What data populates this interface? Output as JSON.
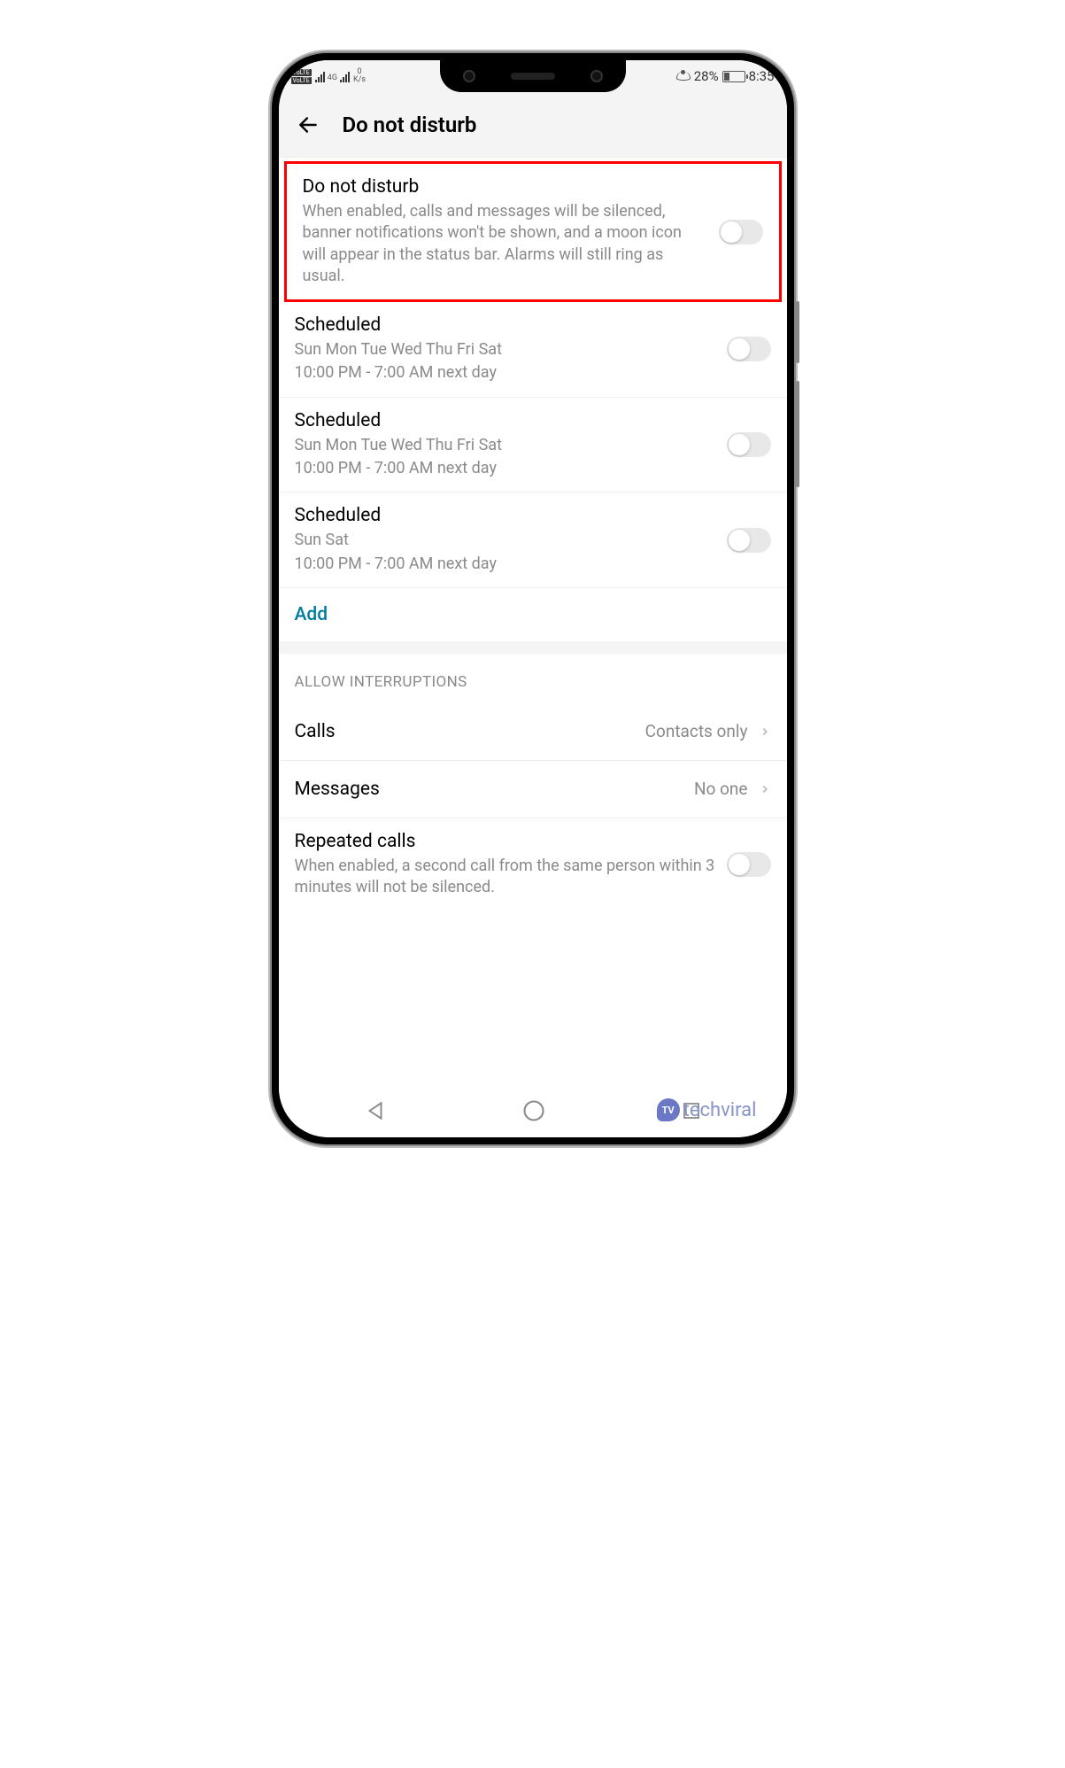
{
  "status": {
    "volte": "VoLTE",
    "net": "4G",
    "speed_top": "0",
    "speed_unit": "K/s",
    "battery_pct": "28%",
    "time": "8:35"
  },
  "header": {
    "title": "Do not disturb"
  },
  "dnd": {
    "title": "Do not disturb",
    "desc": "When enabled, calls and messages will be silenced, banner notifications won't be shown, and a moon icon will appear in the status bar. Alarms will still ring as usual."
  },
  "scheduled": [
    {
      "title": "Scheduled",
      "days": "Sun Mon Tue Wed Thu Fri Sat",
      "time": "10:00 PM - 7:00 AM next day"
    },
    {
      "title": "Scheduled",
      "days": "Sun Mon Tue Wed Thu Fri Sat",
      "time": "10:00 PM - 7:00 AM next day"
    },
    {
      "title": "Scheduled",
      "days": "Sun Sat",
      "time": "10:00 PM - 7:00 AM next day"
    }
  ],
  "add_label": "Add",
  "interruptions": {
    "header": "ALLOW INTERRUPTIONS",
    "calls_label": "Calls",
    "calls_value": "Contacts only",
    "messages_label": "Messages",
    "messages_value": "No one",
    "repeated_title": "Repeated calls",
    "repeated_desc": "When enabled, a second call from the same person within 3 minutes will not be silenced."
  },
  "watermark": {
    "badge": "TV",
    "text": "techviral"
  }
}
